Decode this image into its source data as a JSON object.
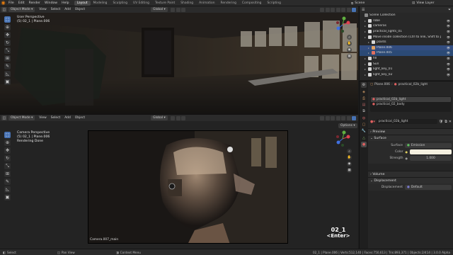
{
  "topbar": {
    "menus": [
      "File",
      "Edit",
      "Render",
      "Window",
      "Help"
    ],
    "workspaces": [
      "Layout",
      "Modeling",
      "Sculpting",
      "UV Editing",
      "Texture Paint",
      "Shading",
      "Animation",
      "Rendering",
      "Compositing",
      "Scripting"
    ],
    "active_workspace": "Layout",
    "scene": "Scene",
    "view_layer": "View Layer"
  },
  "viewport_top": {
    "mode": "Object Mode",
    "menus": [
      "View",
      "Select",
      "Add",
      "Object"
    ],
    "orientation": "Global",
    "overlay_title": "User Perspective",
    "overlay_sub": "(5) 02_1 | Plane.006"
  },
  "viewport_bottom": {
    "mode": "Object Mode",
    "menus": [
      "View",
      "Select",
      "Add",
      "Object"
    ],
    "orientation": "Global",
    "overlay_title": "Camera Perspective",
    "overlay_sub": "(5) 02_1 | Plane.006",
    "overlay_status": "Rendering Done",
    "options_label": "Options",
    "camera_name": "Camera.007_main",
    "frame_name": "02_1",
    "frame_key": "<Enter>"
  },
  "outliner": {
    "header": "Scene Collection",
    "rows": [
      {
        "label": "Scene Collection",
        "indent": 0,
        "color": "#8a8a8a",
        "state": ""
      },
      {
        "label": "robe",
        "indent": 1,
        "color": "#d6d6d6",
        "state": ""
      },
      {
        "label": "cameras",
        "indent": 1,
        "color": "#d6d6d6",
        "state": ""
      },
      {
        "label": "practical_lights_01",
        "indent": 1,
        "color": "#d6d6d6",
        "state": ""
      },
      {
        "label": "Move inside collection (Ctrl to link, Shift to parent)",
        "indent": 1,
        "color": "#d6d6d6",
        "state": ""
      },
      {
        "label": "plants",
        "indent": 2,
        "color": "#d6d6d6",
        "state": ""
      },
      {
        "label": "Plane.006",
        "indent": 2,
        "color": "#e0a060",
        "state": "sel"
      },
      {
        "label": "Plane.005",
        "indent": 2,
        "color": "#e07060",
        "state": "sel2"
      },
      {
        "label": "fill",
        "indent": 1,
        "color": "#d6d6d6",
        "state": ""
      },
      {
        "label": "Sun",
        "indent": 1,
        "color": "#d6d6d6",
        "state": ""
      },
      {
        "label": "light_key_01",
        "indent": 1,
        "color": "#d6d6d6",
        "state": ""
      },
      {
        "label": "light_key_02",
        "indent": 1,
        "color": "#d6d6d6",
        "state": ""
      }
    ]
  },
  "properties": {
    "breadcrumb_object": "Plane.006",
    "breadcrumb_material": "practical_02b_light",
    "material_slots": [
      "practical_02b_light",
      "practical_02_body"
    ],
    "material_name": "practical_02b_light",
    "panels": {
      "preview": "Preview",
      "surface": "Surface",
      "surface_label": "Surface",
      "surface_value": "Emission",
      "color_label": "Color",
      "strength_label": "Strength",
      "strength_value": "1.000",
      "volume": "Volume",
      "displacement": "Displacement",
      "displacement_label": "Displacement",
      "displacement_value": "Default"
    }
  },
  "statusbar": {
    "items": [
      "Select",
      "Pan View",
      "Context Menu"
    ],
    "stats": "02_1 | Plane.006 | Verts:512,140 | Faces:750,613 | Tris:893,371 | Objects:2/414 | 3.0.0 Alpha"
  },
  "colors": {
    "accent": "#4772b3",
    "blender_orange": "#e87d0d",
    "emission_color": "#f4f0e0"
  }
}
